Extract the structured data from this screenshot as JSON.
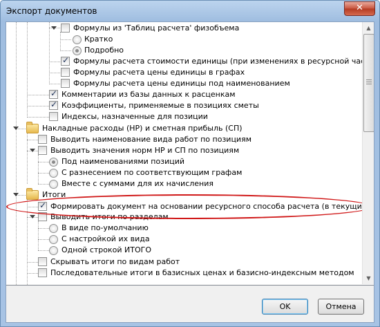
{
  "window": {
    "title": "Экспорт документов",
    "close_label": "✕"
  },
  "tree": {
    "items": [
      {
        "id": "formulas-physvol",
        "label": "Формулы из 'Таблиц расчета' физобъема",
        "kind": "checkbox",
        "checked": false
      },
      {
        "id": "brief",
        "label": "Кратко",
        "kind": "radio",
        "selected": false
      },
      {
        "id": "detailed",
        "label": "Подробно",
        "kind": "radio",
        "selected": true
      },
      {
        "id": "unit-cost-formulas",
        "label": "Формулы расчета стоимости единицы (при изменениях в ресурсной части)",
        "kind": "checkbox",
        "checked": true
      },
      {
        "id": "unit-price-in-columns",
        "label": "Формулы расчета цены единицы в графах",
        "kind": "checkbox",
        "checked": false
      },
      {
        "id": "unit-price-under-name",
        "label": "Формулы расчета цены единицы под наименованием",
        "kind": "checkbox",
        "checked": false
      },
      {
        "id": "db-comments",
        "label": "Комментарии из базы данных к расценкам",
        "kind": "checkbox",
        "checked": true
      },
      {
        "id": "coefficients",
        "label": "Коэффициенты, применяемые в позициях сметы",
        "kind": "checkbox",
        "checked": true
      },
      {
        "id": "indices",
        "label": "Индексы, назначенные для позиции",
        "kind": "checkbox",
        "checked": false
      },
      {
        "id": "overhead-folder",
        "label": "Накладные расходы (НР) и сметная прибыль (СП)",
        "kind": "folder"
      },
      {
        "id": "work-type-name",
        "label": "Выводить наименование вида работ по позициям",
        "kind": "checkbox",
        "checked": false
      },
      {
        "id": "norm-values",
        "label": "Выводить значения норм НР и СП по позициям",
        "kind": "checkbox",
        "checked": false
      },
      {
        "id": "under-names",
        "label": "Под наименованиями позиций",
        "kind": "radio",
        "selected": true
      },
      {
        "id": "split-columns",
        "label": "С разнесением по соответствующим графам",
        "kind": "radio",
        "selected": false
      },
      {
        "id": "with-sums",
        "label": "Вместе с суммами для их начисления",
        "kind": "radio",
        "selected": false
      },
      {
        "id": "totals-folder",
        "label": "Итоги",
        "kind": "folder"
      },
      {
        "id": "resource-method",
        "label": "Формировать документ на основании ресурсного способа расчета (в текущих ценах)",
        "kind": "checkbox",
        "checked": true
      },
      {
        "id": "totals-by-sections",
        "label": "Выводить итоги по разделам",
        "kind": "checkbox",
        "checked": false
      },
      {
        "id": "default-view",
        "label": "В виде по-умолчанию",
        "kind": "radio",
        "selected": false
      },
      {
        "id": "custom-view",
        "label": "С настройкой их вида",
        "kind": "radio",
        "selected": false
      },
      {
        "id": "single-line",
        "label": "Одной строкой ИТОГО",
        "kind": "radio",
        "selected": false
      },
      {
        "id": "hide-work-totals",
        "label": "Скрывать итоги по видам работ",
        "kind": "checkbox",
        "checked": false
      },
      {
        "id": "sequential-totals",
        "label": "Последовательные итоги в базисных ценах и базисно-индексным методом",
        "kind": "checkbox",
        "checked": false
      }
    ]
  },
  "scrollbar": {
    "up_glyph": "▲",
    "down_glyph": "▼",
    "position_fraction": 0.0
  },
  "buttons": {
    "ok": "OK",
    "cancel": "Отмена"
  },
  "colors": {
    "highlight_oval": "#d01818",
    "check_mark": "#21355c"
  },
  "check_glyph": "✓"
}
